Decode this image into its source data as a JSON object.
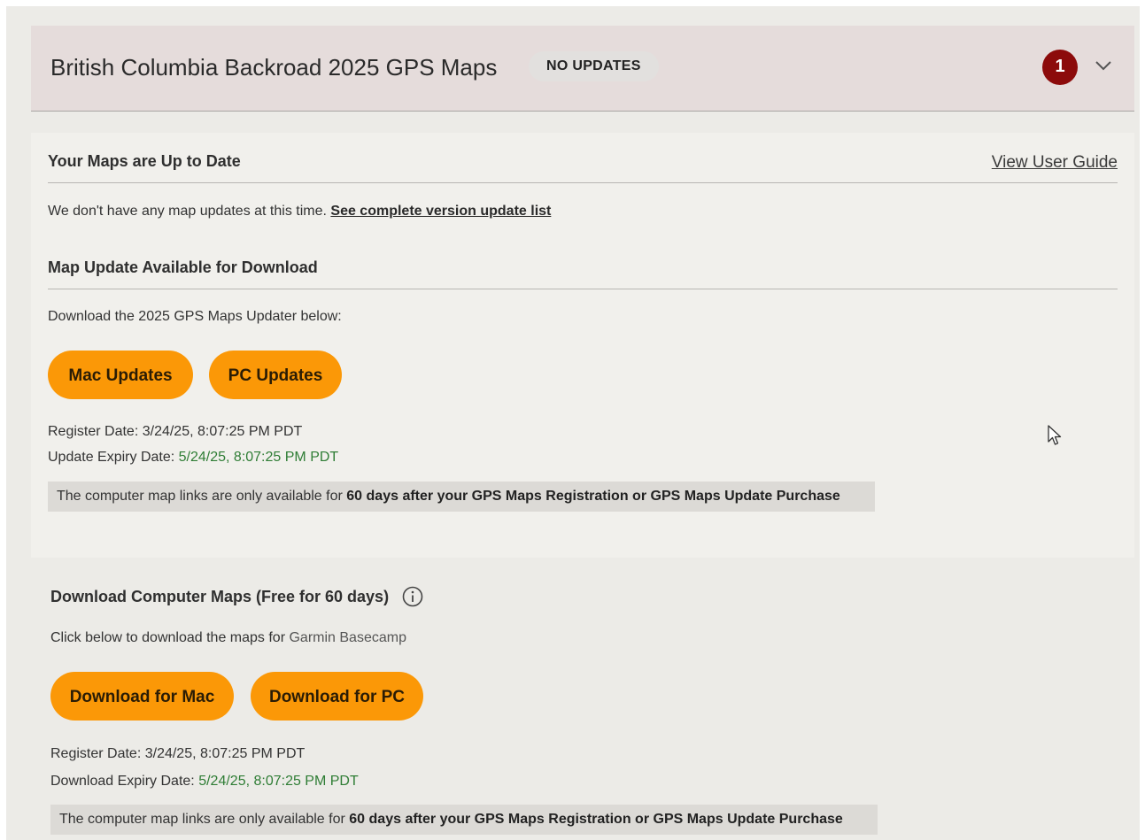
{
  "header": {
    "title": "British Columbia Backroad 2025 GPS Maps",
    "status_badge": "NO UPDATES",
    "notification_count": "1",
    "expand_icon": "chevron-down-icon"
  },
  "updates_card": {
    "heading": "Your Maps are Up to Date",
    "user_guide_link": "View User Guide",
    "no_updates_text": "We don't have any map updates at this time.",
    "version_list_link": "See complete version update list",
    "download_heading": "Map Update Available for Download",
    "download_text": "Download the 2025 GPS Maps Updater below:",
    "mac_button": "Mac Updates",
    "pc_button": "PC Updates",
    "register_label": "Register Date:",
    "register_value": "3/24/25, 8:07:25 PM PDT",
    "expiry_label": "Update Expiry Date:",
    "expiry_value": "5/24/25, 8:07:25 PM PDT",
    "note_prefix": "The computer map links are only available for",
    "note_bold": "60 days after your GPS Maps Registration or GPS Maps Update Purchase"
  },
  "computer_maps": {
    "heading": "Download Computer Maps (Free for 60 days)",
    "info_icon": "info-icon",
    "text_prefix": "Click below to download the maps for",
    "text_app": "Garmin Basecamp",
    "mac_button": "Download for Mac",
    "pc_button": "Download for PC",
    "register_label": "Register Date:",
    "register_value": "3/24/25, 8:07:25 PM PDT",
    "expiry_label": "Download Expiry Date:",
    "expiry_value": "5/24/25, 8:07:25 PM PDT",
    "note_prefix": "The computer map links are only available for",
    "note_bold": "60 days after your GPS Maps Registration or GPS Maps Update Purchase"
  },
  "colors": {
    "accent_button": "#fb9807",
    "count_badge": "#8c0b0b",
    "date_green": "#2f7d35",
    "header_bg": "#e5dcdb"
  }
}
